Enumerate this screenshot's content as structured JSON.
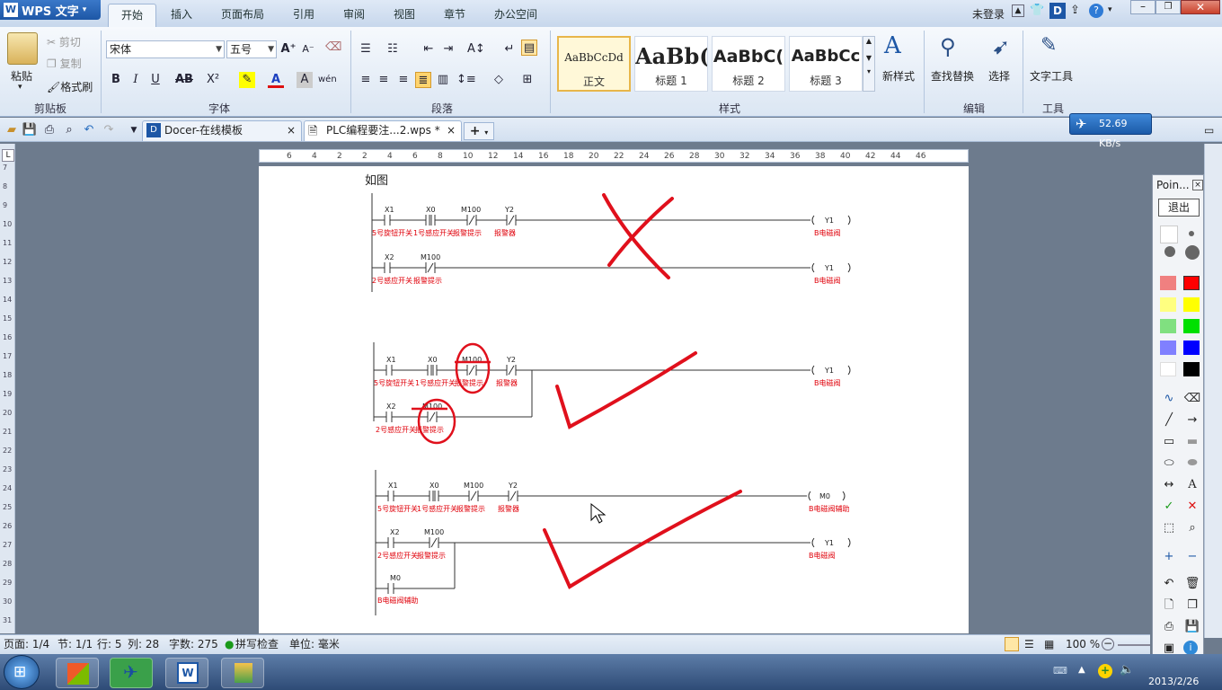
{
  "app": {
    "name": "WPS 文字",
    "logo": "W",
    "user": "未登录"
  },
  "tabs": [
    "开始",
    "插入",
    "页面布局",
    "引用",
    "审阅",
    "视图",
    "章节",
    "办公空间"
  ],
  "ribbon": {
    "clipboard": {
      "paste": "粘贴",
      "cut": "剪切",
      "copy": "复制",
      "format_painter": "格式刷",
      "label": "剪贴板"
    },
    "font": {
      "name": "宋体",
      "size": "五号",
      "label": "字体"
    },
    "paragraph": {
      "label": "段落"
    },
    "styles": {
      "items": [
        {
          "sample": "AaBbCcDd",
          "name": "正文"
        },
        {
          "sample": "AaBb(",
          "name": "标题 1"
        },
        {
          "sample": "AaBbC(",
          "name": "标题 2"
        },
        {
          "sample": "AaBbCc",
          "name": "标题 3"
        }
      ],
      "new_style": "新样式",
      "label": "样式"
    },
    "edit": {
      "find": "查找替换",
      "select": "选择",
      "label": "编辑"
    },
    "tools": {
      "text_tools": "文字工具",
      "label": "工具"
    }
  },
  "doc_tabs": [
    {
      "title": "Docer-在线模板"
    },
    {
      "title": "PLC编程要注...2.wps *"
    }
  ],
  "net_speed": "52.69 KB/s",
  "ruler": {
    "labels": [
      "6",
      "4",
      "2",
      "2",
      "4",
      "6",
      "8",
      "10",
      "12",
      "14",
      "16",
      "18",
      "20",
      "22",
      "24",
      "26",
      "28",
      "30",
      "32",
      "34",
      "36",
      "38",
      "40",
      "42",
      "44",
      "46"
    ]
  },
  "vruler": {
    "labels": [
      "7",
      "8",
      "9",
      "10",
      "11",
      "12",
      "13",
      "14",
      "15",
      "16",
      "17",
      "18",
      "19",
      "20",
      "21",
      "22",
      "23",
      "24",
      "25",
      "26",
      "27",
      "28",
      "29",
      "30",
      "31"
    ]
  },
  "document": {
    "caption": "如图",
    "d1": {
      "row1": {
        "contacts": [
          "X1",
          "X0",
          "M100",
          "Y2"
        ],
        "labels": [
          "5号旋钮开关",
          "1号感应开关",
          "报警提示",
          "报警器"
        ],
        "coil": "Y1",
        "coil_label": "B电磁阀"
      },
      "row2": {
        "contacts": [
          "X2",
          "M100"
        ],
        "labels": [
          "2号感应开关",
          "报警提示"
        ],
        "coil": "Y1",
        "coil_label": "B电磁阀"
      }
    },
    "d2": {
      "row1": {
        "contacts": [
          "X1",
          "X0",
          "M100",
          "Y2"
        ],
        "labels": [
          "5号旋钮开关",
          "1号感应开关",
          "报警提示",
          "报警器"
        ],
        "coil": "Y1",
        "coil_label": "B电磁阀"
      },
      "row2": {
        "contacts": [
          "X2",
          "M100"
        ],
        "labels": [
          "2号感应开关",
          "报警提示"
        ]
      }
    },
    "d3": {
      "row1": {
        "contacts": [
          "X1",
          "X0",
          "M100",
          "Y2"
        ],
        "labels": [
          "5号旋钮开关",
          "1号感应开关",
          "报警提示",
          "报警器"
        ],
        "coil": "M0",
        "coil_label": "B电磁阀辅助"
      },
      "row2": {
        "contacts": [
          "X2",
          "M100"
        ],
        "labels": [
          "2号感应开关",
          "报警提示"
        ],
        "coil": "Y1",
        "coil_label": "B电磁阀"
      },
      "row3": {
        "contacts": [
          "M0"
        ],
        "labels": [
          "B电磁阀辅助"
        ]
      }
    }
  },
  "status": {
    "page": "页面: 1/4",
    "section": "节: 1/1",
    "row": "行: 5",
    "col": "列: 28",
    "words": "字数: 275",
    "spell": "拼写检查",
    "unit": "单位: 毫米",
    "zoom": "100 %"
  },
  "pointer_panel": {
    "title": "Poin...",
    "exit": "退出"
  },
  "clock": {
    "date": "2013/2/26"
  },
  "colors": {
    "ink": "#e0101c",
    "accent": "#1d57a6"
  }
}
